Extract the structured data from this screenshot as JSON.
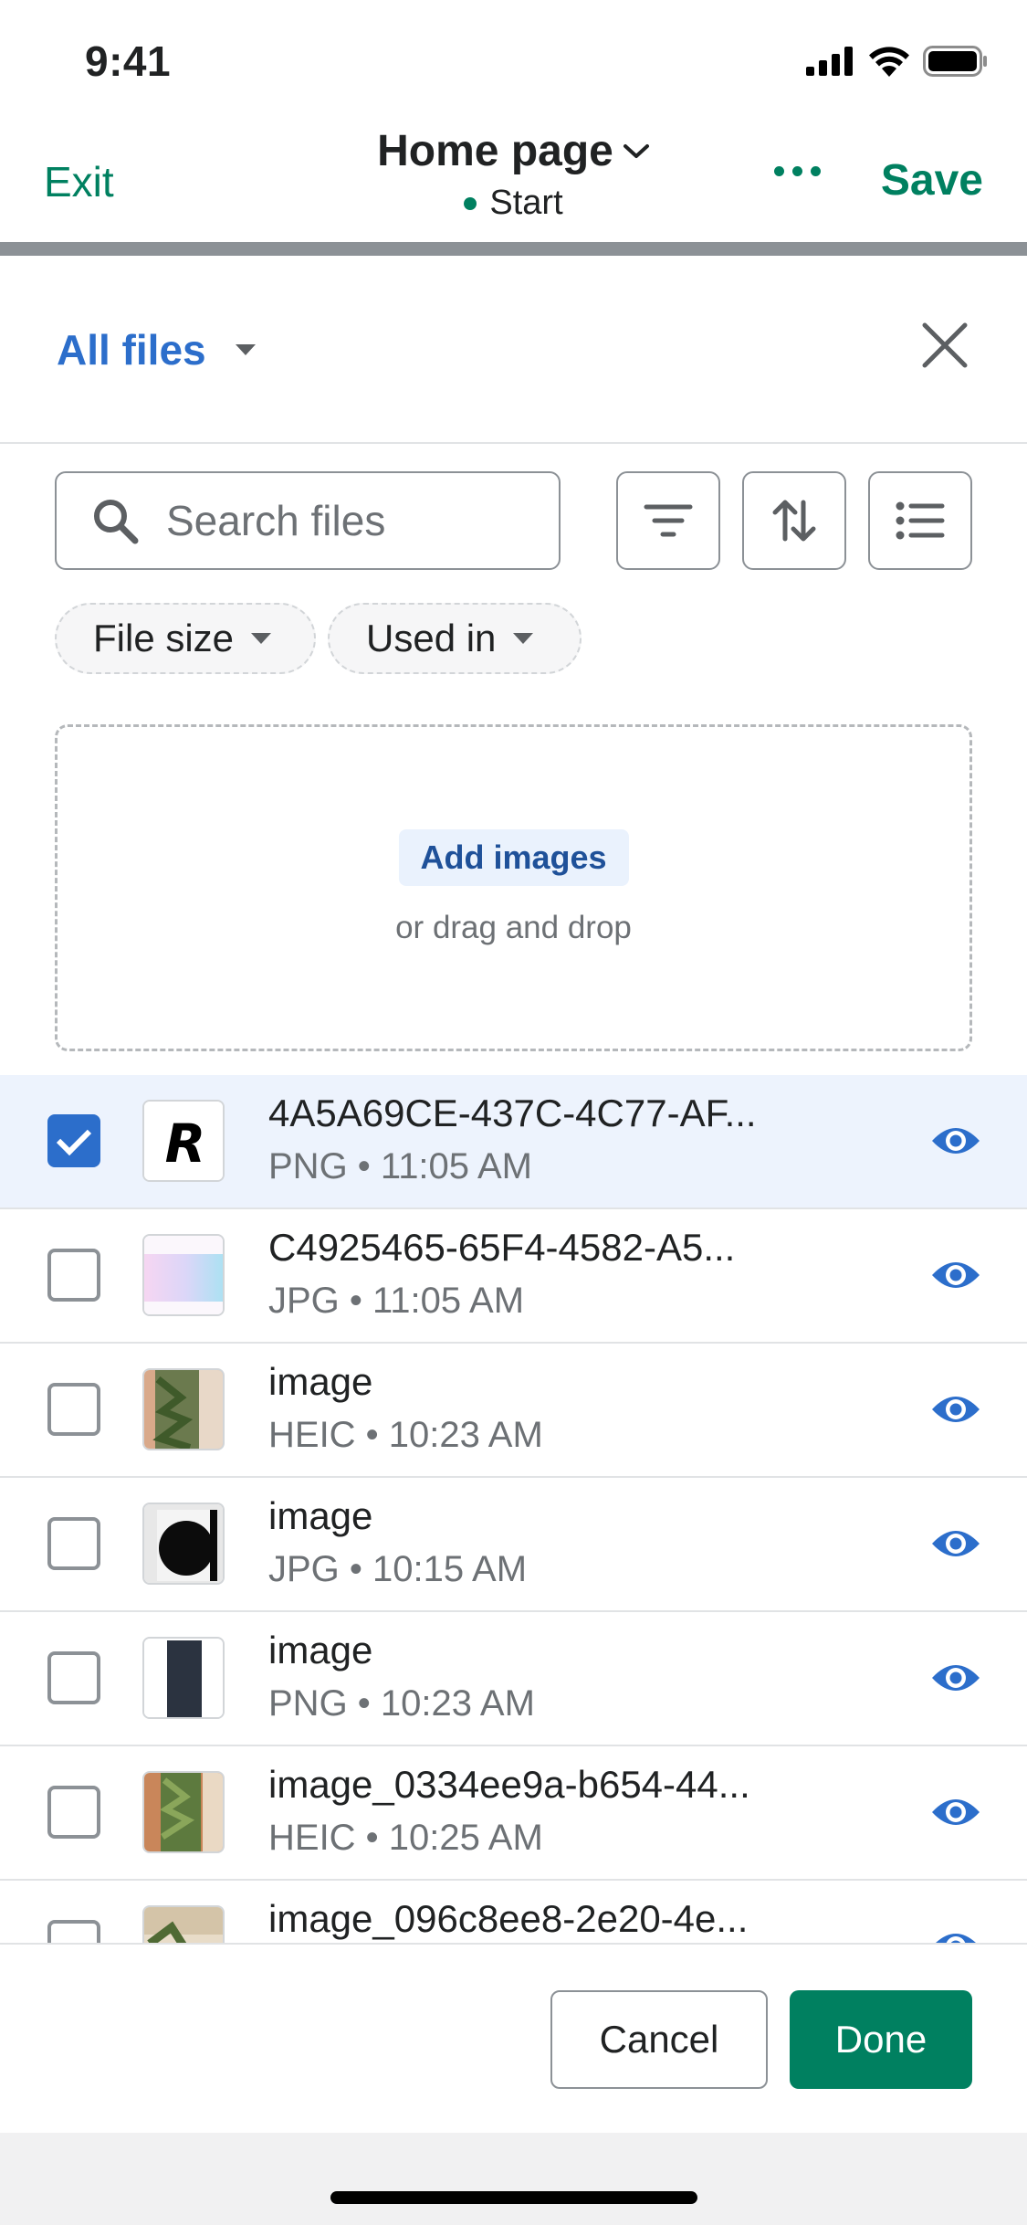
{
  "status_bar": {
    "time": "9:41"
  },
  "app_bar": {
    "exit_label": "Exit",
    "title": "Home page",
    "status_text": "Start",
    "save_label": "Save"
  },
  "modal": {
    "scope_label": "All files"
  },
  "search": {
    "placeholder": "Search files"
  },
  "filters": {
    "file_size_label": "File size",
    "used_in_label": "Used in"
  },
  "dropzone": {
    "add_label": "Add images",
    "hint": "or drag and drop"
  },
  "files": [
    {
      "name": "4A5A69CE-437C-4C77-AF...",
      "meta": "PNG • 11:05 AM",
      "selected": true
    },
    {
      "name": "C4925465-65F4-4582-A5...",
      "meta": "JPG • 11:05 AM",
      "selected": false
    },
    {
      "name": "image",
      "meta": "HEIC • 10:23 AM",
      "selected": false
    },
    {
      "name": "image",
      "meta": "JPG • 10:15 AM",
      "selected": false
    },
    {
      "name": "image",
      "meta": "PNG • 10:23 AM",
      "selected": false
    },
    {
      "name": "image_0334ee9a-b654-44...",
      "meta": "HEIC • 10:25 AM",
      "selected": false
    },
    {
      "name": "image_096c8ee8-2e20-4e...",
      "meta": "",
      "selected": false
    }
  ],
  "footer": {
    "cancel_label": "Cancel",
    "done_label": "Done"
  },
  "colors": {
    "brand_green": "#008060",
    "link_blue": "#2c6ecb",
    "selected_row": "#edf3fd"
  }
}
